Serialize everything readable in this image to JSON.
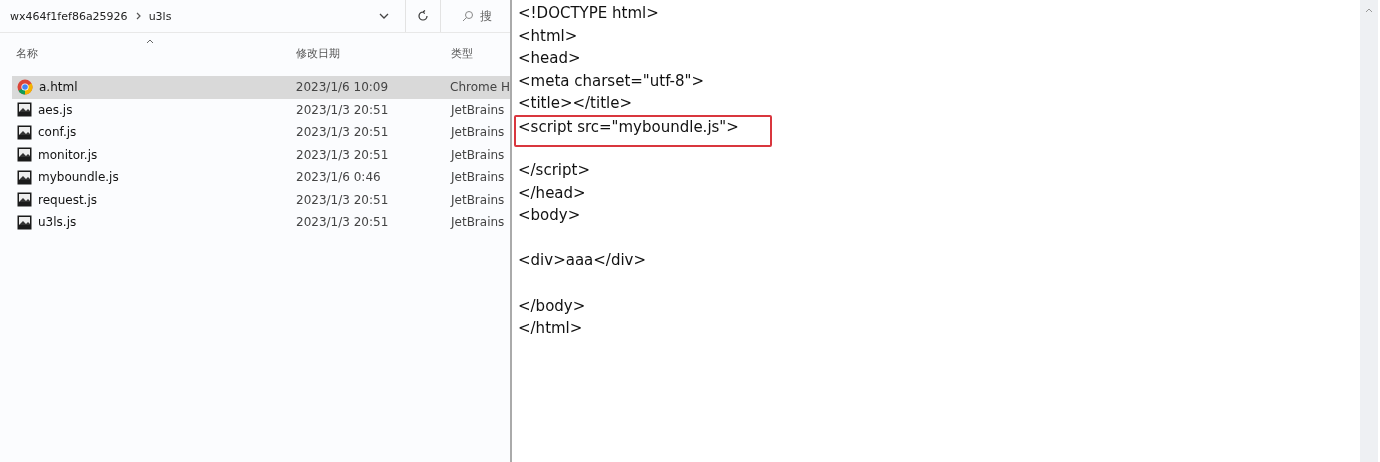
{
  "explorer": {
    "breadcrumb": [
      {
        "label": "wx464f1fef86a25926"
      },
      {
        "label": "u3ls"
      }
    ],
    "search": {
      "placeholder": "搜"
    },
    "columns": [
      "名称",
      "修改日期",
      "类型"
    ],
    "files": [
      {
        "name": "a.html",
        "date": "2023/1/6 10:09",
        "type": "Chrome H",
        "kind": "browser",
        "selected": true
      },
      {
        "name": "aes.js",
        "date": "2023/1/3 20:51",
        "type": "JetBrains",
        "kind": "script",
        "selected": false
      },
      {
        "name": "conf.js",
        "date": "2023/1/3 20:51",
        "type": "JetBrains",
        "kind": "script",
        "selected": false
      },
      {
        "name": "monitor.js",
        "date": "2023/1/3 20:51",
        "type": "JetBrains",
        "kind": "script",
        "selected": false
      },
      {
        "name": "myboundle.js",
        "date": "2023/1/6 0:46",
        "type": "JetBrains",
        "kind": "script",
        "selected": false
      },
      {
        "name": "request.js",
        "date": "2023/1/3 20:51",
        "type": "JetBrains",
        "kind": "script",
        "selected": false
      },
      {
        "name": "u3ls.js",
        "date": "2023/1/3 20:51",
        "type": "JetBrains",
        "kind": "script",
        "selected": false
      }
    ]
  },
  "editor": {
    "blocks": [
      {
        "lines": [
          {
            "text": "<!DOCTYPE html>",
            "highlighted": false
          },
          {
            "text": "<html>",
            "highlighted": false
          },
          {
            "text": "<head>",
            "highlighted": false
          },
          {
            "text": "<meta charset=\"utf-8\">",
            "highlighted": false
          },
          {
            "text": "<title></title>",
            "highlighted": false
          },
          {
            "text": "<script src=\"myboundle.js\">",
            "highlighted": true
          },
          {
            "text": "</script>",
            "highlighted": false
          },
          {
            "text": "</head>",
            "highlighted": false
          },
          {
            "text": "<body>",
            "highlighted": false
          }
        ]
      },
      {
        "lines": [
          {
            "text": "<div>aaa</div>",
            "highlighted": false
          }
        ]
      },
      {
        "lines": [
          {
            "text": "</body>",
            "highlighted": false
          },
          {
            "text": "</html>",
            "highlighted": false
          }
        ]
      }
    ]
  }
}
